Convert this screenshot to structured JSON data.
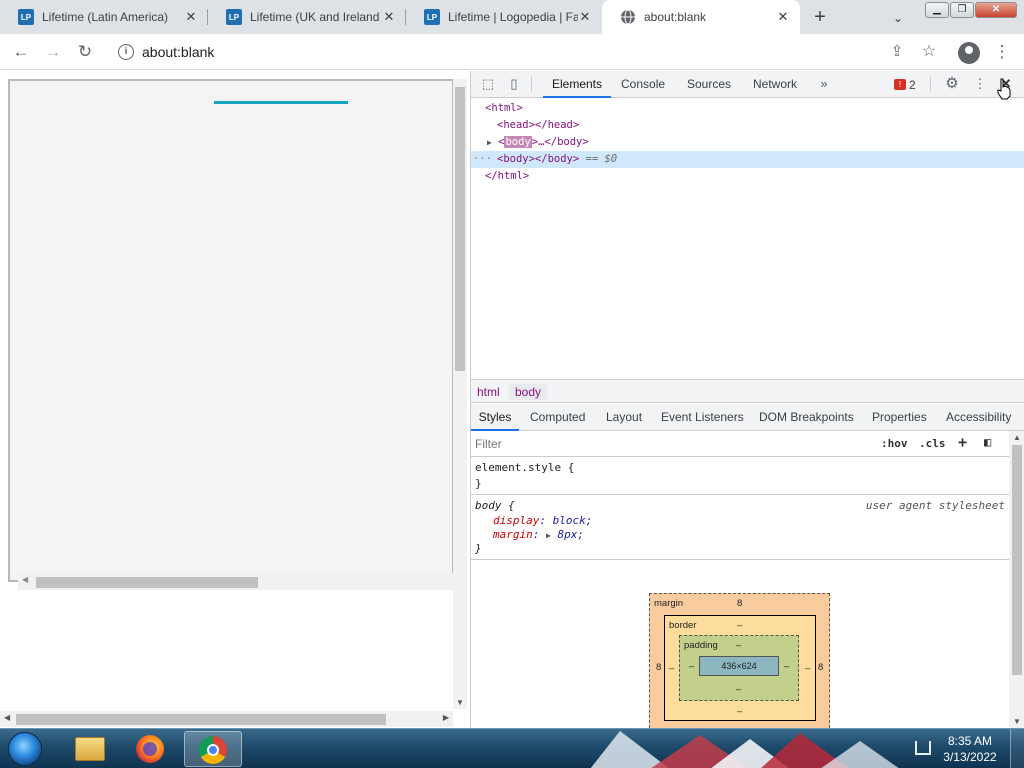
{
  "browser": {
    "tabs": [
      {
        "title": "Lifetime (Latin America) |",
        "favicon": "LP"
      },
      {
        "title": "Lifetime (UK and Ireland) |",
        "favicon": "LP"
      },
      {
        "title": "Lifetime | Logopedia | Fa",
        "favicon": "LP"
      },
      {
        "title": "about:blank",
        "favicon": "globe-icon"
      }
    ],
    "address": "about:blank"
  },
  "devtools": {
    "main_tabs": [
      "Elements",
      "Console",
      "Sources",
      "Network"
    ],
    "issues_count": "2",
    "dom": {
      "html_open": "<html>",
      "head": "<head></head>",
      "body_collapsed_lt": "<",
      "body_collapsed_tag": "body",
      "body_collapsed_rest": ">…</body>",
      "body_selected": "<body></body>",
      "body_selected_suffix": "== $0",
      "html_close": "</html>",
      "dots": "···"
    },
    "breadcrumbs": [
      "html",
      "body"
    ],
    "sub_tabs": [
      "Styles",
      "Computed",
      "Layout",
      "Event Listeners",
      "DOM Breakpoints",
      "Properties",
      "Accessibility"
    ],
    "filter_placeholder": "Filter",
    "filter_hov": ":hov",
    "filter_cls": ".cls",
    "styles": {
      "element_style_open": "element.style {",
      "element_style_close": "}",
      "body_selector": "body {",
      "ua_label": "user agent stylesheet",
      "prop1_name": "display",
      "prop1_value": "block;",
      "prop2_name": "margin",
      "prop2_value": "8px;",
      "body_close": "}"
    },
    "box_model": {
      "margin_label": "margin",
      "margin_top": "8",
      "margin_left": "8",
      "margin_right": "8",
      "border_label": "border",
      "border_top": "–",
      "padding_label": "padding",
      "padding_top": "–",
      "padding_left": "–",
      "padding_right": "–",
      "padding_bottom": "–",
      "border_left": "–",
      "border_right": "–",
      "border_bottom": "–",
      "content": "436×624",
      "margin_bottom": "–"
    }
  },
  "taskbar": {
    "time": "8:35 AM",
    "date": "3/13/2022"
  },
  "colors": {
    "accent_line": "#16a3bf",
    "dev_tab_underline": "#1a73e8",
    "tag_color": "#881280"
  }
}
